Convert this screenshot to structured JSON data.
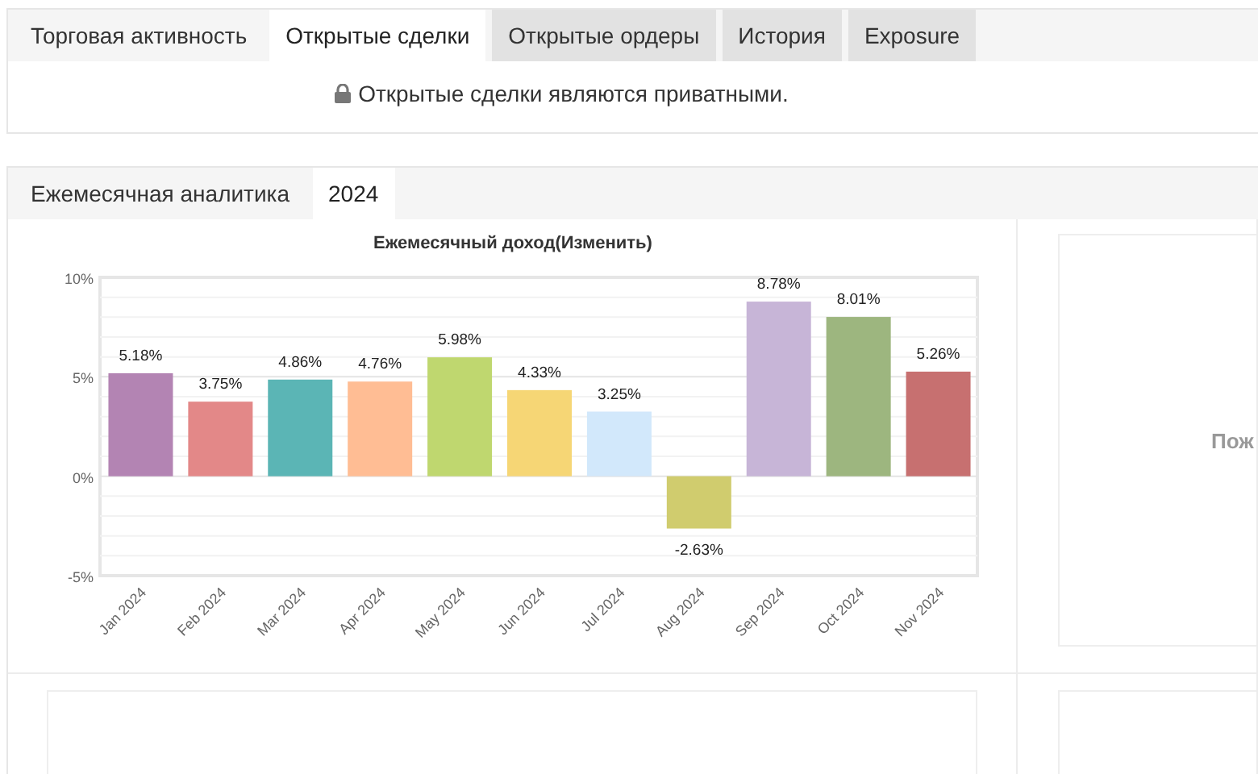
{
  "top_tabs": [
    {
      "label": "Торговая активность",
      "selected": false
    },
    {
      "label": "Открытые сделки",
      "selected": true
    },
    {
      "label": "Открытые ордеры",
      "selected": false
    },
    {
      "label": "История",
      "selected": false
    },
    {
      "label": "Exposure",
      "selected": false
    }
  ],
  "private_notice": "Открытые сделки являются приватными.",
  "analytics": {
    "title": "Ежемесячная аналитика",
    "year_tabs": [
      {
        "label": "2024",
        "selected": true
      }
    ],
    "chart": {
      "title": "Ежемесячный доход(Изменить)",
      "chart_data": {
        "type": "bar",
        "categories": [
          "Jan 2024",
          "Feb 2024",
          "Mar 2024",
          "Apr 2024",
          "May 2024",
          "Jun 2024",
          "Jul 2024",
          "Aug 2024",
          "Sep 2024",
          "Oct 2024",
          "Nov 2024"
        ],
        "values": [
          5.18,
          3.75,
          4.86,
          4.76,
          5.98,
          4.33,
          3.25,
          -2.63,
          8.78,
          8.01,
          5.26
        ],
        "colors": [
          "#b384b3",
          "#e38888",
          "#5bb5b5",
          "#ffbd94",
          "#bfd76f",
          "#f6d675",
          "#d2e8fb",
          "#d0cc6e",
          "#c7b5d7",
          "#9db67f",
          "#c77070"
        ],
        "ylim": [
          -5,
          10
        ],
        "yticks": [
          {
            "value": 10,
            "label": "10%"
          },
          {
            "value": 5,
            "label": "5%"
          },
          {
            "value": 0,
            "label": "0%"
          },
          {
            "value": -5,
            "label": "-5%"
          }
        ],
        "value_labels": [
          "5.18%",
          "3.75%",
          "4.86%",
          "4.76%",
          "5.98%",
          "4.33%",
          "3.25%",
          "-2.63%",
          "8.78%",
          "8.01%",
          "5.26%"
        ]
      }
    },
    "side_message": "Пож"
  }
}
